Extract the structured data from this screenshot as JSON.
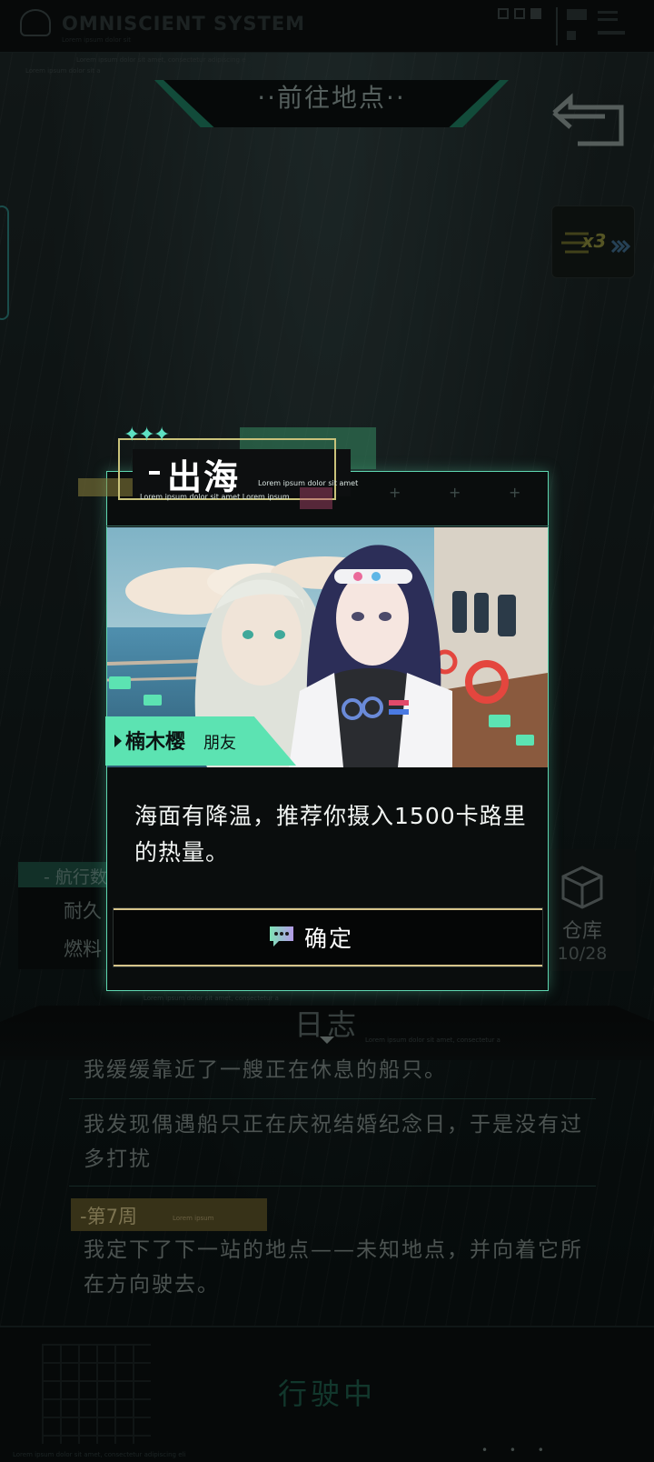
{
  "topbar": {
    "system_title": "OMNISCIENT SYSTEM",
    "system_sub": "Lorem ipsum dolor sit",
    "ticker_line1": "Lorem ipsum dolor sit amet, consectetur adipiscing e",
    "ticker_line2": "Lorem ipsum dolor sit a"
  },
  "destination": {
    "title": "··前往地点··"
  },
  "speed_badge": {
    "text": "x3"
  },
  "nav_panel": {
    "title": "- 航行数据",
    "row1": "耐久",
    "row2": "燃料"
  },
  "warehouse": {
    "label": "仓库",
    "count": "10/28"
  },
  "modal": {
    "title": "出海",
    "subtitle1": "Lorem ipsum dolor sit amet",
    "subtitle2": "Lorem ipsum dolor sit amet Lorem ipsum",
    "speaker_name": "楠木樱",
    "speaker_role": "朋友",
    "message": "海面有降温，推荐你摄入1500卡路里的热量。",
    "confirm_label": "确定"
  },
  "log": {
    "title": "日志",
    "ticker1": "Lorem ipsum dolor sit amet, consectetur a",
    "ticker2": "Lorem ipsum dolor sit amet, consectetur a",
    "entries": [
      "我缓缓靠近了一艘正在休息的船只。",
      "我发现偶遇船只正在庆祝结婚纪念日，于是没有过多打扰"
    ],
    "week_label": "-第7周",
    "week_sub": "Lorem ipsum",
    "entry3": "我定下了下一站的地点——未知地点，并向着它所在方向驶去。"
  },
  "bottom": {
    "status": "行驶中",
    "ticker": "Lorem ipsum dolor sit amet, consectetur adipiscing eli"
  },
  "colors": {
    "accent": "#5fd6b0",
    "confirm_border": "#d6c48a",
    "speaker_plate": "#5ce3b2"
  }
}
